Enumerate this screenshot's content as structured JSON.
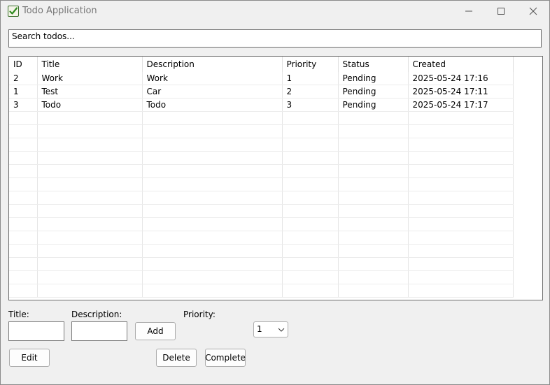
{
  "window": {
    "title": "Todo Application",
    "icon": "checkbox-check-icon"
  },
  "search": {
    "placeholder": "Search todos..."
  },
  "table": {
    "columns": [
      "ID",
      "Title",
      "Description",
      "Priority",
      "Status",
      "Created"
    ],
    "rows": [
      [
        "2",
        "Work",
        " Work",
        "1",
        "Pending",
        "2025-05-24 17:16"
      ],
      [
        "1",
        "Test",
        "Car",
        "2",
        "Pending",
        "2025-05-24 17:11"
      ],
      [
        "3",
        "Todo",
        "Todo",
        "3",
        "Pending",
        "2025-05-24 17:17"
      ]
    ]
  },
  "form": {
    "title_label": "Title:",
    "description_label": "Description:",
    "priority_label": "Priority:",
    "title_value": "",
    "description_value": "",
    "priority_selected": "1",
    "add_label": "Add",
    "edit_label": "Edit",
    "delete_label": "Delete",
    "complete_label": "Complete"
  }
}
